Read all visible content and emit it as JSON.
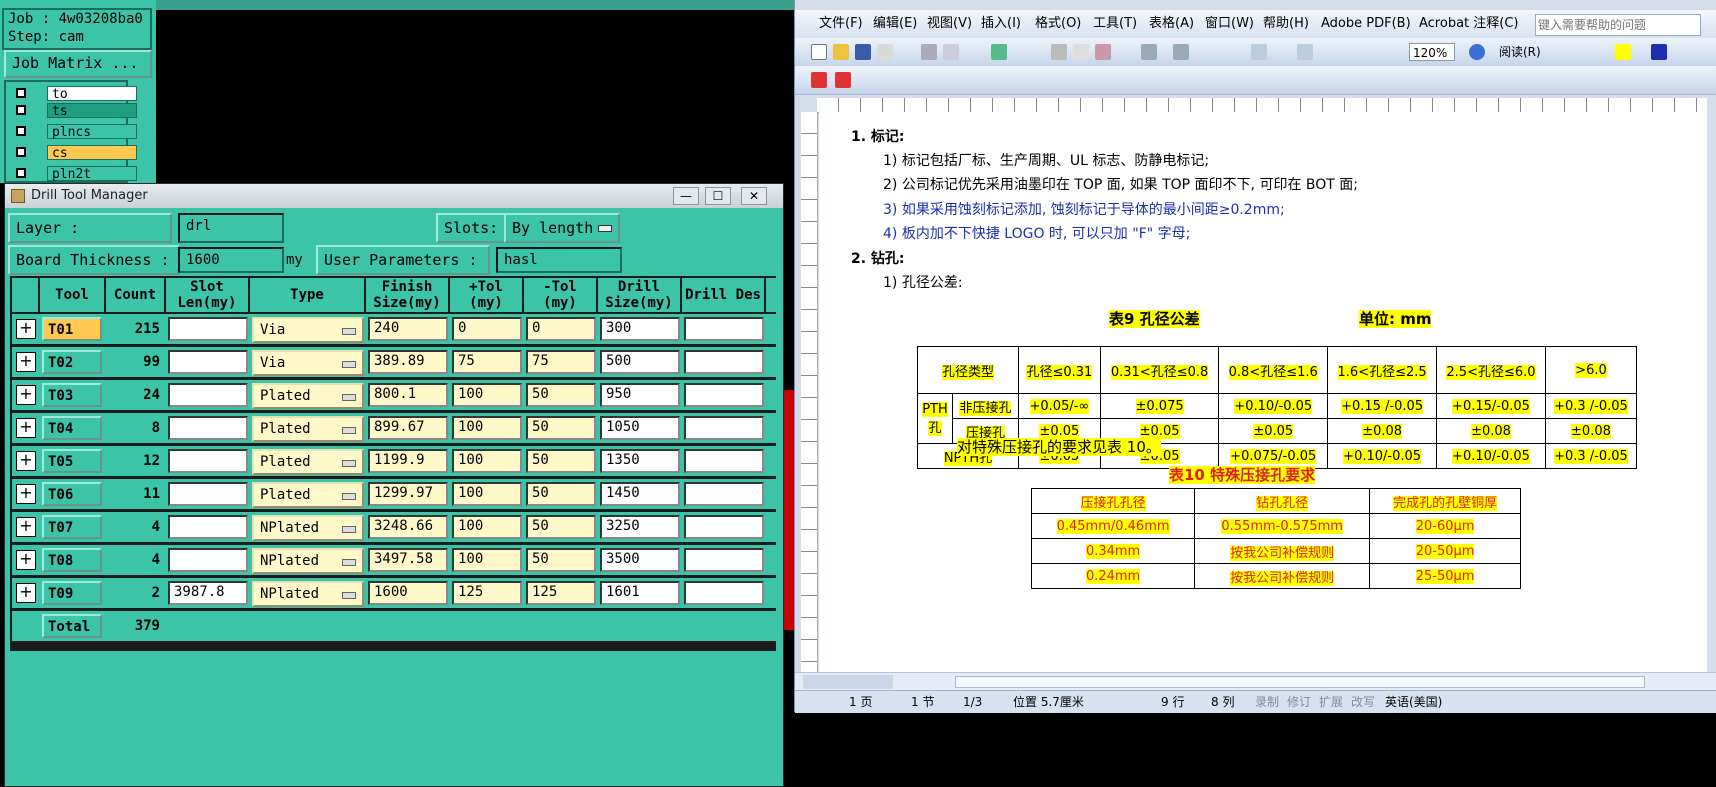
{
  "cam": {
    "job": "Job : 4w03208ba0",
    "step": "Step: cam",
    "job_matrix": "Job Matrix ...",
    "layers": [
      {
        "name": "to",
        "color": "#ffffff"
      },
      {
        "name": "ts",
        "color": "#1e9e7e"
      },
      {
        "name": "plncs",
        "color": "#3cc4a8"
      },
      {
        "name": "cs",
        "color": "#ffc850"
      },
      {
        "name": "pln2t",
        "color": "#3cc4a8"
      }
    ]
  },
  "drill": {
    "title": "Drill Tool Manager",
    "layer_label": "Layer              :",
    "layer_value": "drl",
    "slots_label": "Slots:",
    "slots_value": "By length",
    "thickness_label": "Board Thickness :",
    "thickness_value": "1600",
    "thickness_unit": "my",
    "user_params_label": "User Parameters :",
    "user_params_value": "hasl",
    "headers": [
      "Tool",
      "Count",
      "Slot Len(my)",
      "Type",
      "Finish Size(my)",
      "+Tol (my)",
      "-Tol (my)",
      "Drill Size(my)",
      "Drill Des"
    ],
    "rows": [
      {
        "tool": "T01",
        "count": "215",
        "slot": "",
        "type": "Via",
        "finish": "240",
        "ptol": "0",
        "mtol": "0",
        "drill": "300",
        "des": ""
      },
      {
        "tool": "T02",
        "count": "99",
        "slot": "",
        "type": "Via",
        "finish": "389.89",
        "ptol": "75",
        "mtol": "75",
        "drill": "500",
        "des": ""
      },
      {
        "tool": "T03",
        "count": "24",
        "slot": "",
        "type": "Plated",
        "finish": "800.1",
        "ptol": "100",
        "mtol": "50",
        "drill": "950",
        "des": ""
      },
      {
        "tool": "T04",
        "count": "8",
        "slot": "",
        "type": "Plated",
        "finish": "899.67",
        "ptol": "100",
        "mtol": "50",
        "drill": "1050",
        "des": ""
      },
      {
        "tool": "T05",
        "count": "12",
        "slot": "",
        "type": "Plated",
        "finish": "1199.9",
        "ptol": "100",
        "mtol": "50",
        "drill": "1350",
        "des": ""
      },
      {
        "tool": "T06",
        "count": "11",
        "slot": "",
        "type": "Plated",
        "finish": "1299.97",
        "ptol": "100",
        "mtol": "50",
        "drill": "1450",
        "des": ""
      },
      {
        "tool": "T07",
        "count": "4",
        "slot": "",
        "type": "NPlated",
        "finish": "3248.66",
        "ptol": "100",
        "mtol": "50",
        "drill": "3250",
        "des": ""
      },
      {
        "tool": "T08",
        "count": "4",
        "slot": "",
        "type": "NPlated",
        "finish": "3497.58",
        "ptol": "100",
        "mtol": "50",
        "drill": "3500",
        "des": ""
      },
      {
        "tool": "T09",
        "count": "2",
        "slot": "3987.8",
        "type": "NPlated",
        "finish": "1600",
        "ptol": "125",
        "mtol": "125",
        "drill": "1601",
        "des": ""
      }
    ],
    "total_label": "Total",
    "total_value": "379"
  },
  "word": {
    "menus": [
      "文件(F)",
      "编辑(E)",
      "视图(V)",
      "插入(I)",
      "格式(O)",
      "工具(T)",
      "表格(A)",
      "窗口(W)",
      "帮助(H)",
      "Adobe PDF(B)",
      "Acrobat 注释(C)"
    ],
    "help_placeholder": "键入需要帮助的问题",
    "zoom": "120%",
    "read_label": "阅读(R)",
    "doc": {
      "h1": "1.   标记:",
      "p1": "1)  标记包括厂标、生产周期、UL 标志、防静电标记;",
      "p2": "2)  公司标记优先采用油墨印在 TOP 面, 如果 TOP 面印不下, 可印在 BOT 面;",
      "p3": "3)  如果采用蚀刻标记添加, 蚀刻标记于导体的最小间距≥0.2mm;",
      "p4": "4)  板内加不下快捷 LOGO 时, 可以只加 \"F\" 字母;",
      "h2": "2.   钻孔:",
      "p5": "1)  孔径公差:",
      "t9_title": "表9   孔径公差",
      "t9_unit": "单位: mm",
      "t9_headers": [
        "孔径类型",
        "孔径≤0.31",
        "0.31<孔径≤0.8",
        "0.8<孔径≤1.6",
        "1.6<孔径≤2.5",
        "2.5<孔径≤6.0",
        ">6.0"
      ],
      "t9_pth": "PTH孔",
      "t9_rows": [
        {
          "label": "非压接孔",
          "vals": [
            "+0.05/-∞",
            "±0.075",
            "+0.10/-0.05",
            "+0.15 /-0.05",
            "+0.15/-0.05",
            "+0.3 /-0.05"
          ]
        },
        {
          "label": "压接孔",
          "vals": [
            "±0.05",
            "±0.05",
            "±0.05",
            "±0.08",
            "±0.08",
            "±0.08"
          ]
        },
        {
          "label": "NPTH孔",
          "vals": [
            "±0.05",
            "±0.05",
            "+0.075/-0.05",
            "+0.10/-0.05",
            "+0.10/-0.05",
            "+0.3 /-0.05"
          ]
        }
      ],
      "t10_note": "对特殊压接孔的要求见表 10。",
      "t10_title": "表10   特殊压接孔要求",
      "t10_headers": [
        "压接孔孔径",
        "钻孔孔径",
        "完成孔的孔壁铜厚"
      ],
      "t10_rows": [
        [
          "0.45mm/0.46mm",
          "0.55mm-0.575mm",
          "20-60μm"
        ],
        [
          "0.34mm",
          "按我公司补偿规则",
          "20-50μm"
        ],
        [
          "0.24mm",
          "按我公司补偿规则",
          "25-50μm"
        ]
      ]
    },
    "status": {
      "page": "1 页",
      "section": "1 节",
      "pages": "1/3",
      "pos": "位置 5.7厘米",
      "line": "9 行",
      "col": "8 列",
      "rec": "录制",
      "trk": "修订",
      "ext": "扩展",
      "ovr": "改写",
      "lang": "英语(美国)"
    }
  }
}
